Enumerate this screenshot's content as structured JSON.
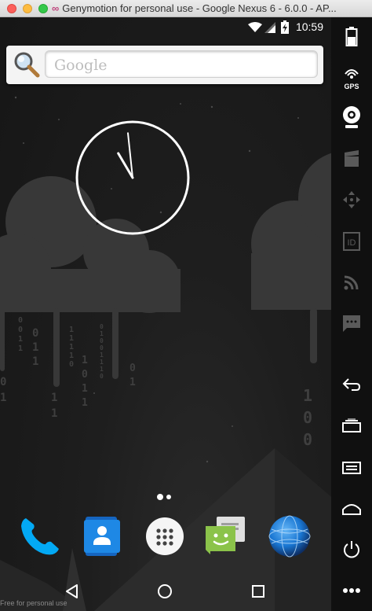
{
  "window": {
    "title": "Genymotion for personal use - Google Nexus 6 - 6.0.0 - AP..."
  },
  "statusbar": {
    "time": "10:59",
    "icons": [
      "wifi-icon",
      "signal-icon",
      "battery-charging-icon"
    ]
  },
  "search": {
    "placeholder": "Google"
  },
  "clock": {
    "hour": 10,
    "minute": 59
  },
  "homescreen": {
    "page_count": 2,
    "current_page": 0
  },
  "dock": [
    {
      "name": "phone-app-icon",
      "icon": "phone"
    },
    {
      "name": "contacts-app-icon",
      "icon": "contacts"
    },
    {
      "name": "app-drawer-icon",
      "icon": "apps"
    },
    {
      "name": "messenger-app-icon",
      "icon": "messages"
    },
    {
      "name": "browser-app-icon",
      "icon": "globe"
    }
  ],
  "navbar": [
    "back-icon",
    "home-icon",
    "recents-icon"
  ],
  "watermark": "Free for personal use",
  "toolbar": {
    "gps_label": "GPS",
    "tools": [
      "battery-icon",
      "gps-icon",
      "camera-icon",
      "media-icon",
      "dpad-icon",
      "id-icon",
      "network-icon",
      "sms-icon",
      "back-icon",
      "recent-apps-icon",
      "menu-icon",
      "home-icon",
      "power-icon",
      "more-icon"
    ]
  },
  "colors": {
    "screen_bg": "#1b1b1b",
    "toolbar_bg": "#101010",
    "wallpaper_shape": "#3a3a3a",
    "phone_accent": "#03a9f4",
    "messenger_accent": "#8bc34a"
  }
}
